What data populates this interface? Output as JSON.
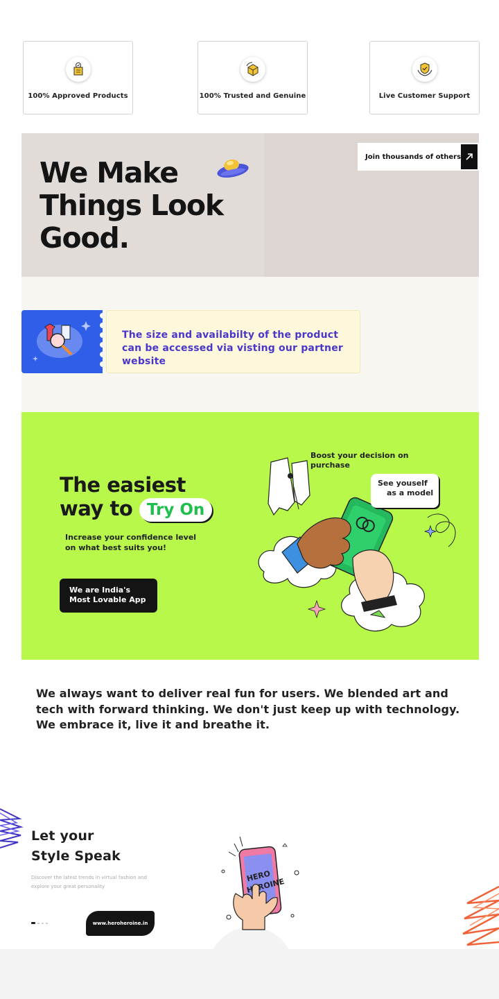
{
  "features": [
    {
      "label": "100% Approved Products",
      "icon": "approved-box-icon"
    },
    {
      "label": "100% Trusted and Genuine",
      "icon": "genuine-box-icon"
    },
    {
      "label": "Live Customer Support",
      "icon": "shield-hands-icon"
    }
  ],
  "hero": {
    "title": "We Make Things Look Good.",
    "join_label": "Join thousands of others",
    "arrow_icon": "arrow-up-right-icon"
  },
  "info": {
    "text": "The size and availabilty of the product can be accessed via visting our partner website",
    "icon": "clothes-search-icon"
  },
  "promo": {
    "title_line1": "The easiest",
    "title_line2": "way to",
    "tryon": "Try On",
    "subtitle": "Increase your confidence level on what best suits you!",
    "button_label": "We are India's Most Lovable App",
    "boost_text": "Boost your decision on purchase",
    "model_line1": "See youself",
    "model_line2": "as a model"
  },
  "mission": "We always want to deliver real fun for users. We blended art and tech with forward thinking. We don't just keep up with technology. We embrace it, live it and breathe it.",
  "style": {
    "title_line1": "Let your",
    "title_line2": "Style Speak",
    "description": "Discover the latest trends in virtual fashion and explore your great personality",
    "url": "www.heroheroine.in",
    "phone_text": "HERO HEROINE"
  },
  "colors": {
    "promo_green": "#b7f84b",
    "ticket_blue": "#2f5fe8",
    "info_text": "#4a37c9",
    "tryon_green": "#1fbf4e"
  }
}
